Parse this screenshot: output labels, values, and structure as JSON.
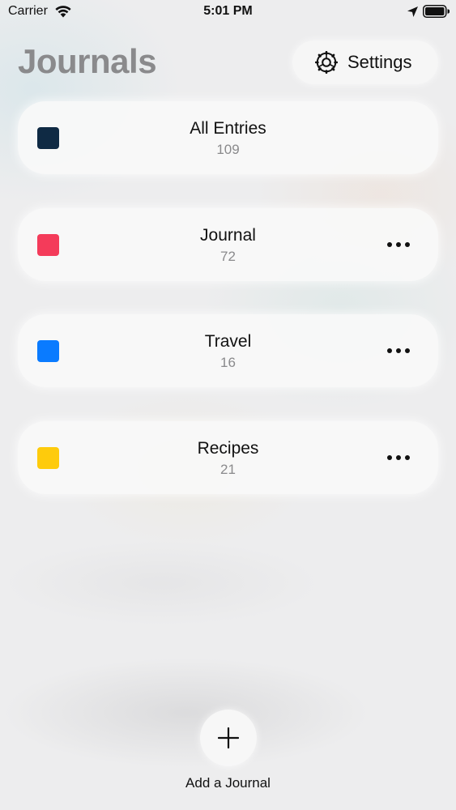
{
  "status_bar": {
    "carrier": "Carrier",
    "time": "5:01 PM",
    "icons": [
      "wifi-icon",
      "location-arrow-icon",
      "battery-icon"
    ]
  },
  "header": {
    "title": "Journals",
    "settings_label": "Settings",
    "settings_icon": "gear-icon"
  },
  "journals": [
    {
      "name": "All Entries",
      "count": "109",
      "color": "#0f2a44",
      "has_menu": false
    },
    {
      "name": "Journal",
      "count": "72",
      "color": "#f43b5a",
      "has_menu": true
    },
    {
      "name": "Travel",
      "count": "16",
      "color": "#0a7bff",
      "has_menu": true
    },
    {
      "name": "Recipes",
      "count": "21",
      "color": "#fecb0c",
      "has_menu": true
    }
  ],
  "add_journal": {
    "label": "Add a Journal",
    "icon": "plus-icon"
  },
  "colors": {
    "title_gray": "#8a8a8c",
    "card_background": "#f8f8f8",
    "text": "#111111"
  }
}
